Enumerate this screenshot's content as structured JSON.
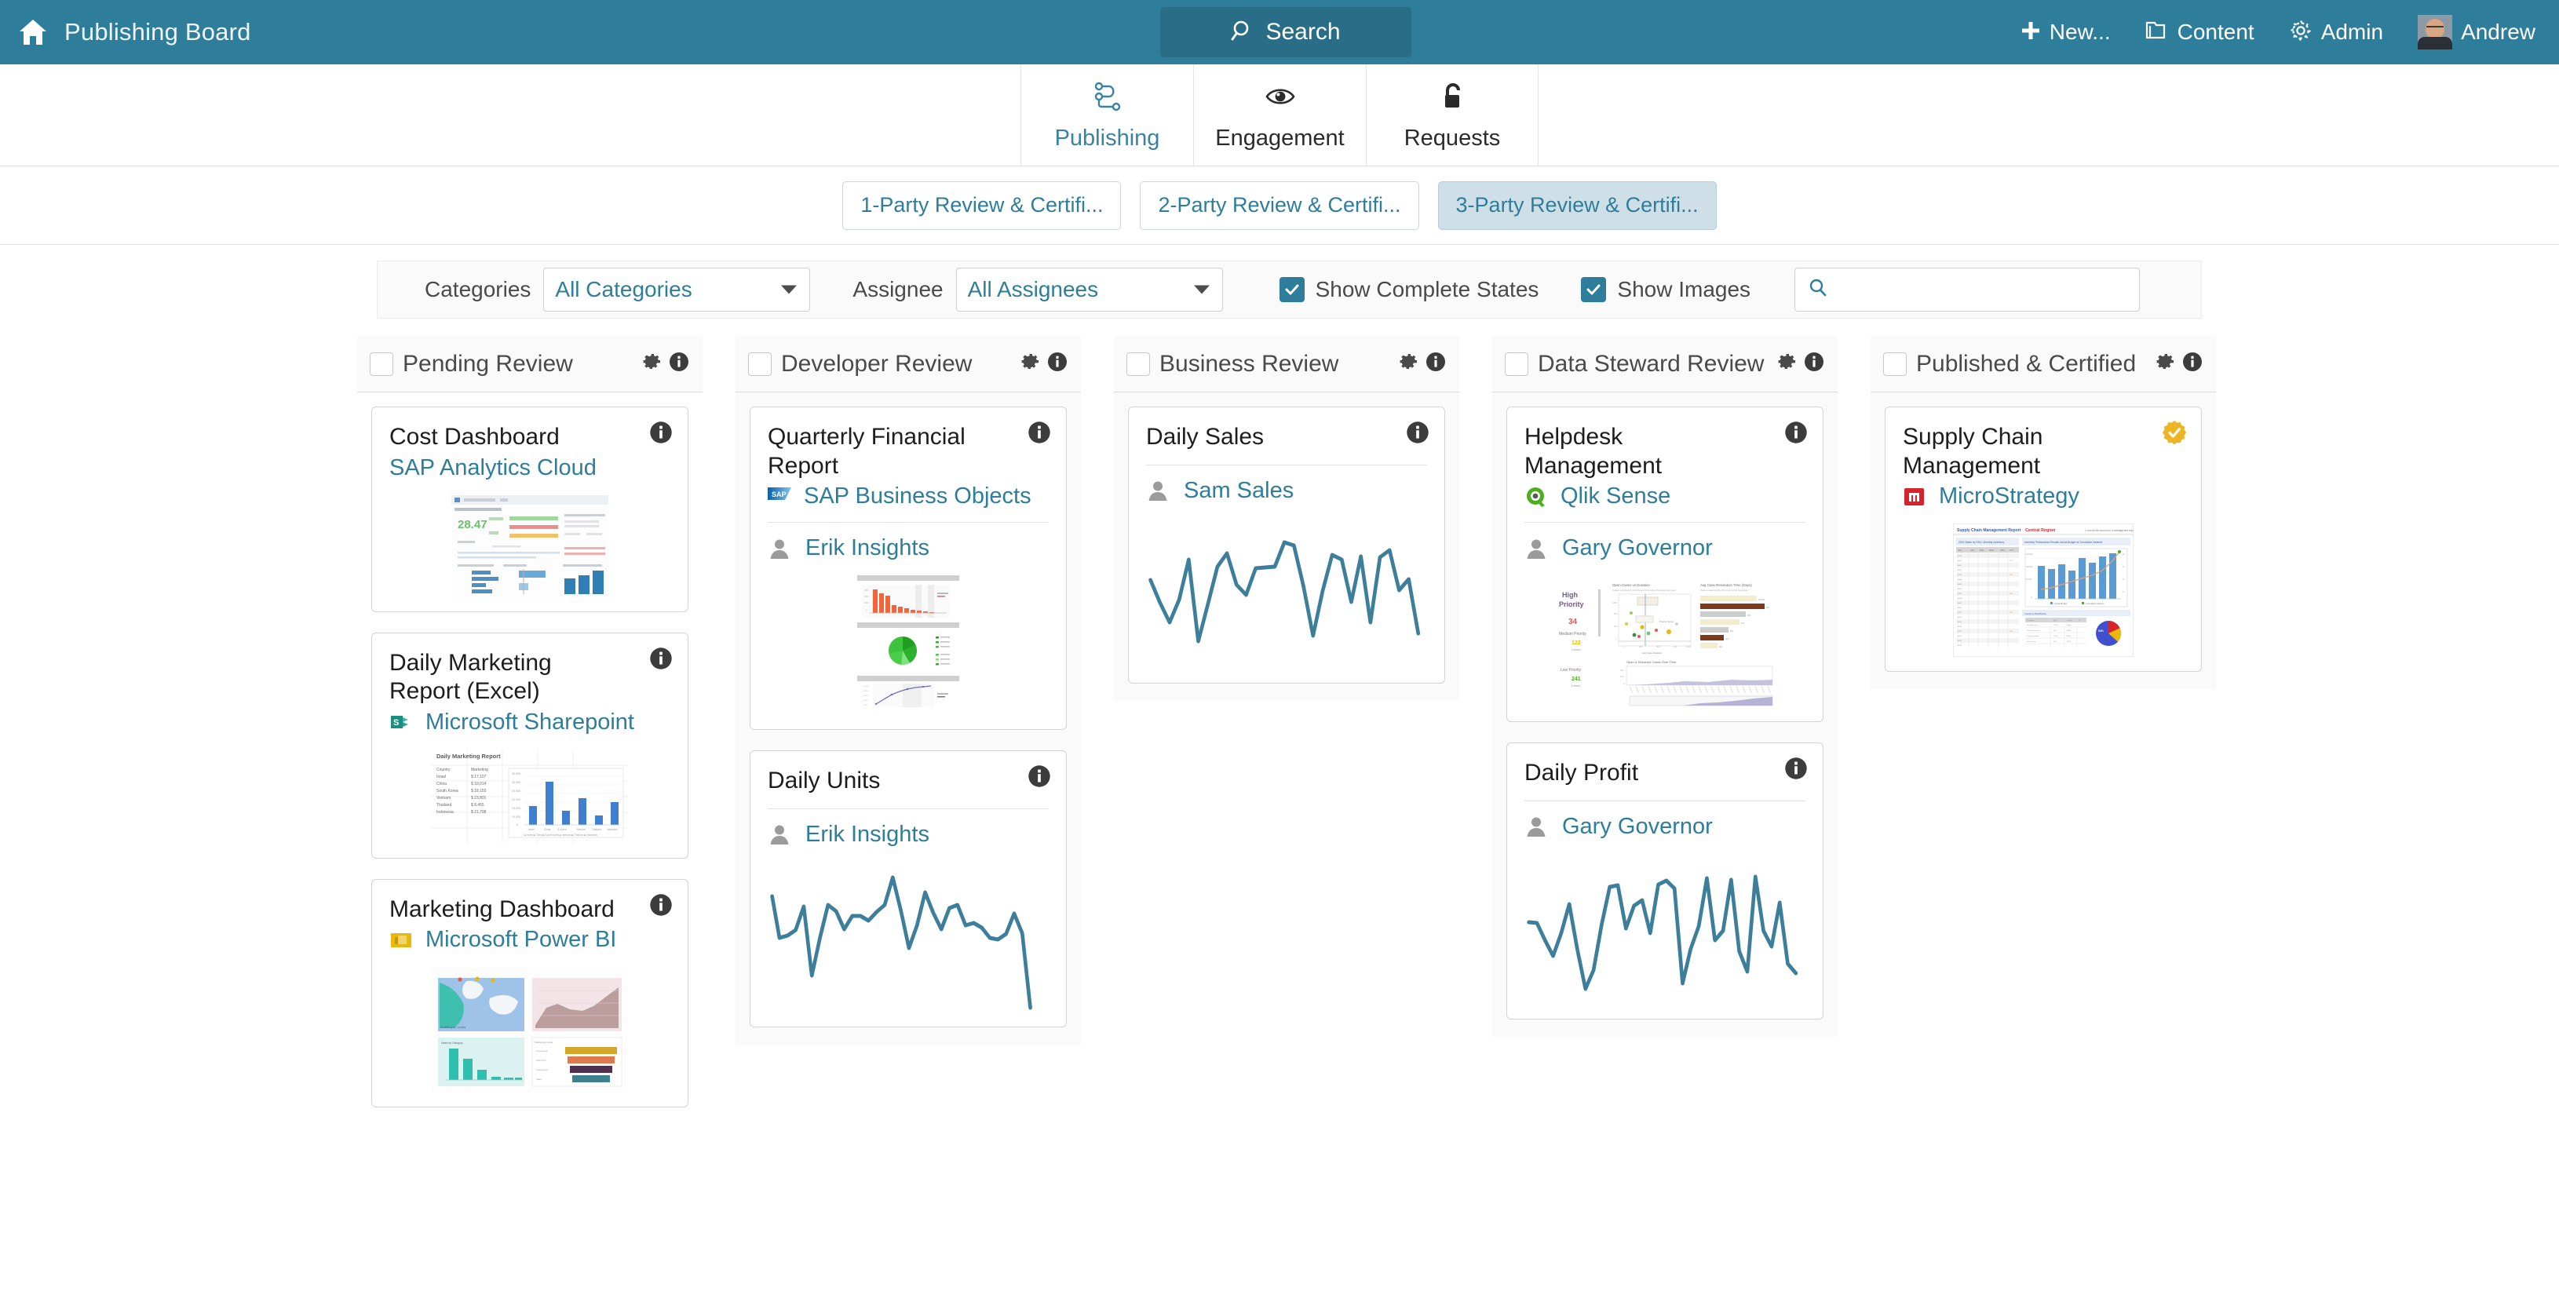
{
  "header": {
    "home_icon": "home-icon",
    "title": "Publishing Board",
    "search_label": "Search",
    "search_icon": "search-icon",
    "new_label": "New...",
    "new_icon": "plus-icon",
    "content_label": "Content",
    "content_icon": "folder-icon",
    "admin_label": "Admin",
    "admin_icon": "gear-icon",
    "user_label": "Andrew",
    "avatar_icon": "avatar"
  },
  "nav_tabs": [
    {
      "label": "Publishing",
      "icon": "workflow-icon",
      "active": true
    },
    {
      "label": "Engagement",
      "icon": "eye-icon",
      "active": false
    },
    {
      "label": "Requests",
      "icon": "unlock-icon",
      "active": false
    }
  ],
  "sub_tabs": [
    {
      "label": "1-Party Review & Certifi...",
      "selected": false
    },
    {
      "label": "2-Party Review & Certifi...",
      "selected": false
    },
    {
      "label": "3-Party Review & Certifi...",
      "selected": true
    }
  ],
  "filters": {
    "categories_label": "Categories",
    "categories_value": "All Categories",
    "assignee_label": "Assignee",
    "assignee_value": "All Assignees",
    "show_complete_states_label": "Show Complete States",
    "show_complete_states_checked": true,
    "show_images_label": "Show Images",
    "show_images_checked": true,
    "search_icon": "search-icon",
    "search_value": "",
    "search_placeholder": ""
  },
  "columns": [
    {
      "title": "Pending Review",
      "checked": false,
      "gear_icon": "gear-icon",
      "info_icon": "info-icon",
      "shaded": false,
      "cards": [
        {
          "title": "Cost Dashboard",
          "source": "SAP Analytics Cloud",
          "source_logo": "none",
          "badge": "info-icon",
          "assignee": null,
          "thumb": "sap-analytics-cloud-dashboard"
        },
        {
          "title": "Daily Marketing Report (Excel)",
          "source": "Microsoft Sharepoint",
          "source_logo": "sharepoint-icon",
          "badge": "info-icon",
          "assignee": null,
          "thumb": "excel-marketing-report"
        },
        {
          "title": "Marketing Dashboard",
          "source": "Microsoft Power BI",
          "source_logo": "powerbi-icon",
          "badge": "info-icon",
          "assignee": null,
          "thumb": "powerbi-marketing-dashboard"
        }
      ]
    },
    {
      "title": "Developer Review",
      "checked": false,
      "gear_icon": "gear-icon",
      "info_icon": "info-icon",
      "shaded": true,
      "cards": [
        {
          "title": "Quarterly Financial Report",
          "source": "SAP Business Objects",
          "source_logo": "sap-bo-icon",
          "badge": "info-icon",
          "assignee": "Erik Insights",
          "thumb": "sap-bo-report"
        },
        {
          "title": "Daily Units",
          "source": null,
          "source_logo": "none",
          "badge": "info-icon",
          "assignee": "Erik Insights",
          "thumb": "sparkline-daily-units"
        }
      ]
    },
    {
      "title": "Business Review",
      "checked": false,
      "gear_icon": "gear-icon",
      "info_icon": "info-icon",
      "shaded": true,
      "cards": [
        {
          "title": "Daily Sales",
          "source": null,
          "source_logo": "none",
          "badge": "info-icon",
          "assignee": "Sam Sales",
          "thumb": "sparkline-daily-sales"
        }
      ]
    },
    {
      "title": "Data Steward Review",
      "checked": false,
      "gear_icon": "gear-icon",
      "info_icon": "info-icon",
      "shaded": true,
      "cards": [
        {
          "title": "Helpdesk Management",
          "source": "Qlik Sense",
          "source_logo": "qlik-icon",
          "badge": "info-icon",
          "assignee": "Gary Governor",
          "thumb": "qlik-helpdesk-dashboard"
        },
        {
          "title": "Daily Profit",
          "source": null,
          "source_logo": "none",
          "badge": "info-icon",
          "assignee": "Gary Governor",
          "thumb": "sparkline-daily-profit"
        }
      ]
    },
    {
      "title": "Published & Certified",
      "checked": false,
      "gear_icon": "gear-icon",
      "info_icon": "info-icon",
      "shaded": true,
      "cards": [
        {
          "title": "Supply Chain Management",
          "source": "MicroStrategy",
          "source_logo": "microstrategy-icon",
          "badge": "certified-icon",
          "assignee": null,
          "thumb": "microstrategy-supply-chain"
        }
      ]
    }
  ],
  "chart_data": [
    {
      "type": "line",
      "title": "Daily Units",
      "name": "sparkline-daily-units",
      "x": [
        0,
        1,
        2,
        3,
        4,
        5,
        6,
        7,
        8,
        9,
        10,
        11,
        12,
        13,
        14,
        15,
        16,
        17,
        18,
        19,
        20,
        21,
        22,
        23,
        24,
        25,
        26,
        27,
        28,
        29,
        30,
        31,
        32,
        33,
        34
      ],
      "values": [
        62,
        38,
        40,
        43,
        58,
        20,
        38,
        57,
        53,
        41,
        50,
        50,
        47,
        52,
        58,
        74,
        54,
        34,
        46,
        61,
        49,
        41,
        55,
        58,
        46,
        47,
        44,
        38,
        37,
        41,
        53,
        40,
        6,
        6,
        6
      ],
      "ylim": [
        0,
        80
      ],
      "grid": false,
      "xlabel": "",
      "ylabel": ""
    },
    {
      "type": "line",
      "title": "Daily Sales",
      "name": "sparkline-daily-sales",
      "x": [
        0,
        1,
        2,
        3,
        4,
        5,
        6,
        7,
        8,
        9,
        10,
        11,
        12,
        13,
        14,
        15,
        16,
        17,
        18,
        19,
        20,
        21,
        22,
        23,
        24,
        25,
        26,
        27,
        28
      ],
      "values": [
        46,
        33,
        22,
        38,
        57,
        16,
        34,
        52,
        58,
        46,
        42,
        53,
        53,
        53,
        65,
        63,
        46,
        20,
        43,
        59,
        56,
        34,
        55,
        26,
        55,
        60,
        38,
        42,
        18
      ],
      "ylim": [
        0,
        80
      ],
      "grid": false,
      "xlabel": "",
      "ylabel": ""
    },
    {
      "type": "line",
      "title": "Daily Profit",
      "name": "sparkline-daily-profit",
      "x": [
        0,
        1,
        2,
        3,
        4,
        5,
        6,
        7,
        8,
        9,
        10,
        11,
        12,
        13,
        14,
        15,
        16,
        17,
        18,
        19,
        20,
        21,
        22,
        23,
        24,
        25,
        26,
        27,
        28,
        29,
        30,
        31,
        32,
        33
      ],
      "values": [
        44,
        43,
        34,
        26,
        39,
        53,
        27,
        12,
        22,
        45,
        62,
        63,
        42,
        55,
        58,
        41,
        63,
        65,
        61,
        22,
        37,
        50,
        64,
        40,
        43,
        62,
        36,
        28,
        65,
        40,
        32,
        55,
        30,
        25
      ],
      "ylim": [
        0,
        80
      ],
      "grid": false,
      "xlabel": "",
      "ylabel": ""
    }
  ]
}
